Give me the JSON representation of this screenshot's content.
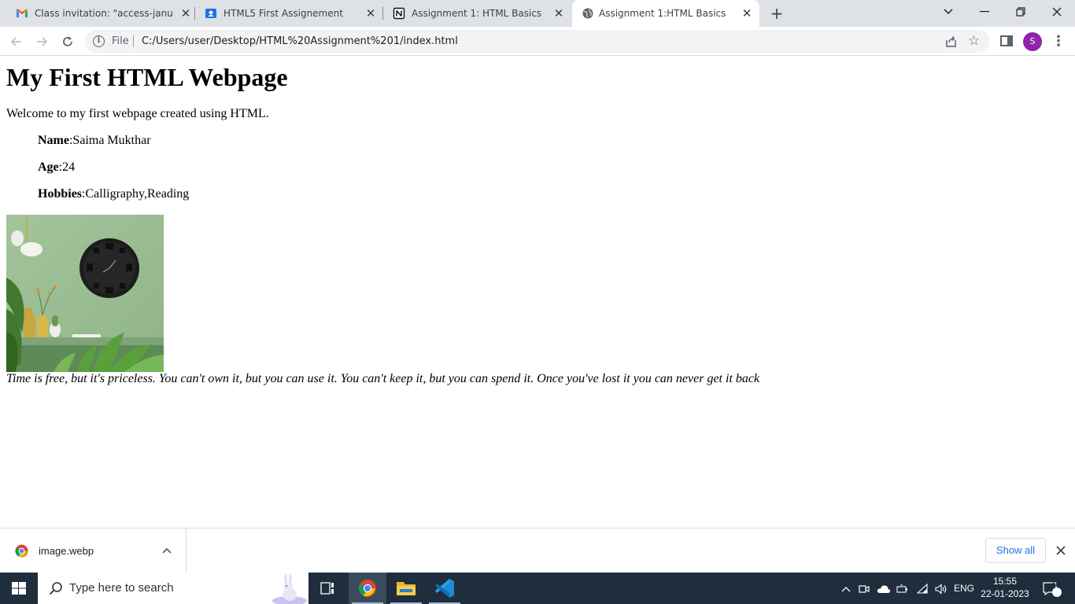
{
  "browser": {
    "tabs": [
      {
        "title": "Class invitation: \"access-january-",
        "icon": "gmail-icon",
        "active": false
      },
      {
        "title": "HTML5 First Assignement",
        "icon": "classroom-icon",
        "active": false
      },
      {
        "title": "Assignment 1: HTML Basics",
        "icon": "notion-icon",
        "active": false
      },
      {
        "title": "Assignment 1:HTML Basics",
        "icon": "globe-icon",
        "active": true
      }
    ],
    "omnibox": {
      "scheme_label": "File",
      "url": "C:/Users/user/Desktop/HTML%20Assignment%201/index.html"
    },
    "profile_initial": "S",
    "colors": {
      "profile": "#8e24aa",
      "tabstrip": "#dee1e6"
    }
  },
  "page": {
    "heading": "My First HTML Webpage",
    "intro": "Welcome to my first webpage created using HTML.",
    "details": [
      {
        "label": "Name",
        "value": ":Saima Mukthar"
      },
      {
        "label": "Age",
        "value": ":24"
      },
      {
        "label": "Hobbies",
        "value": ":Calligraphy,Reading"
      }
    ],
    "image_subject": "wall-clock-with-plants-image",
    "quote": "Time is free, but it's priceless. You can't own it, but you can use it. You can't keep it, but you can spend it. Once you've lost it you can never get it back"
  },
  "downloads": {
    "file_name": "image.webp",
    "show_all_label": "Show all"
  },
  "taskbar": {
    "search_placeholder": "Type here to search",
    "language": "ENG",
    "time": "15:55",
    "date": "22-01-2023",
    "notification_count": "21"
  }
}
